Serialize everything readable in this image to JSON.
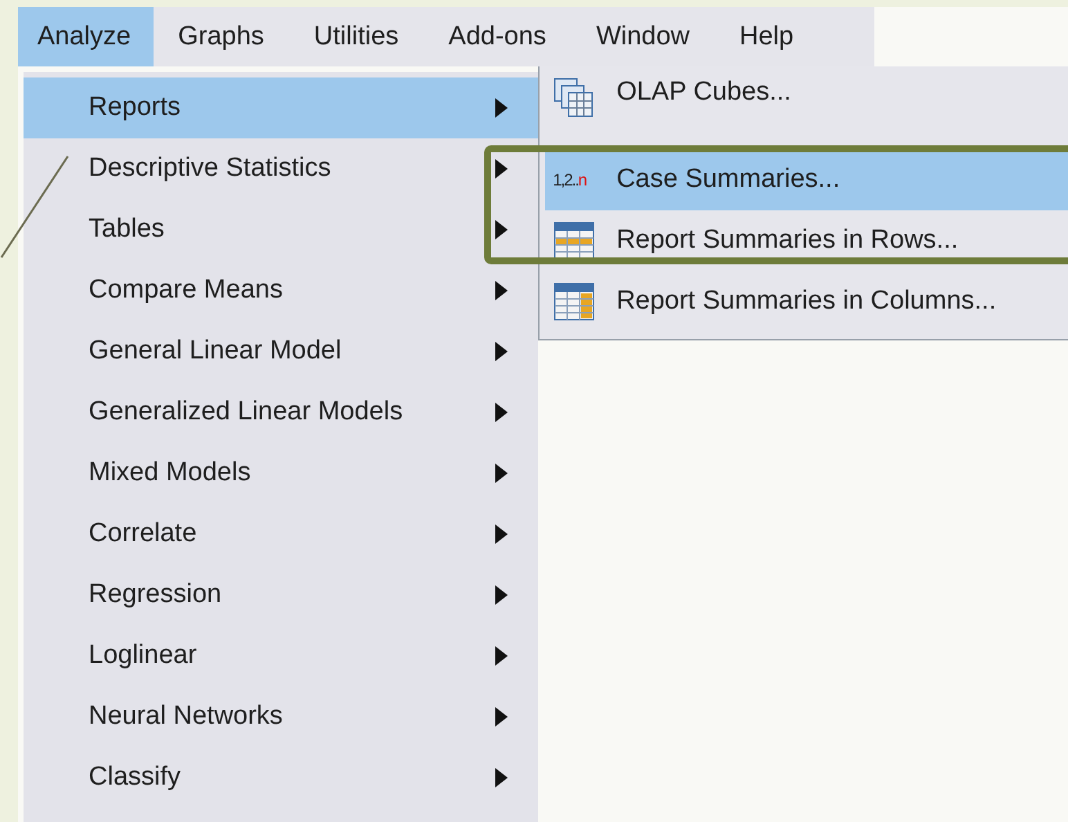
{
  "menubar": [
    {
      "label": "Analyze",
      "selected": true
    },
    {
      "label": "Graphs",
      "selected": false
    },
    {
      "label": "Utilities",
      "selected": false
    },
    {
      "label": "Add-ons",
      "selected": false
    },
    {
      "label": "Window",
      "selected": false
    },
    {
      "label": "Help",
      "selected": false
    }
  ],
  "menu": {
    "items": [
      {
        "label": "Reports",
        "selected": true,
        "submenu": true
      },
      {
        "label": "Descriptive Statistics",
        "selected": false,
        "submenu": true
      },
      {
        "label": "Tables",
        "selected": false,
        "submenu": true
      },
      {
        "label": "Compare Means",
        "selected": false,
        "submenu": true
      },
      {
        "label": "General Linear Model",
        "selected": false,
        "submenu": true
      },
      {
        "label": "Generalized Linear Models",
        "selected": false,
        "submenu": true
      },
      {
        "label": "Mixed Models",
        "selected": false,
        "submenu": true
      },
      {
        "label": "Correlate",
        "selected": false,
        "submenu": true
      },
      {
        "label": "Regression",
        "selected": false,
        "submenu": true
      },
      {
        "label": "Loglinear",
        "selected": false,
        "submenu": true
      },
      {
        "label": "Neural Networks",
        "selected": false,
        "submenu": true
      },
      {
        "label": "Classify",
        "selected": false,
        "submenu": true
      }
    ]
  },
  "submenu": {
    "items": [
      {
        "label": "OLAP Cubes...",
        "selected": false,
        "kind": "cubes"
      },
      {
        "label": "Case Summaries...",
        "selected": true,
        "kind": "sequence",
        "icon_text": [
          "1,2..",
          "n"
        ]
      },
      {
        "label": "Report Summaries in Rows...",
        "selected": false,
        "kind": "rows"
      },
      {
        "label": "Report Summaries in Columns...",
        "selected": false,
        "kind": "columns"
      }
    ]
  }
}
